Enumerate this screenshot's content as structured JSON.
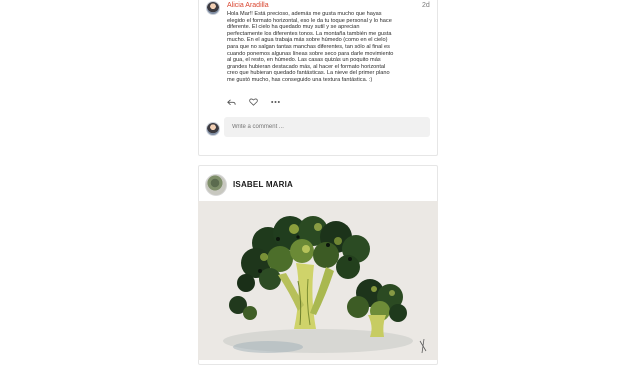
{
  "comment": {
    "author": "Alicia Aradilla",
    "time": "2d",
    "body": "Hola Mar!! Está precioso, además me gusta mucho que hayas\nelegido el formato horizontal, eso le da tu toque personal y lo hace\ndiferente. El cielo ha quedado muy sutil y se aprecian\nperfectamente los diferentes tonos. La montaña también me gusta\nmucho. En el agua trabaja más sobre húmedo (como en el cielo)\npara que no salgan tantas manchas diferentes, tan sólo al final es\ncuando ponemos algunas líneas sobre seco para darle movimiento\nal gua, el resto, en húmedo. Las casas quizás un poquito más\ngrandes hubieran destacado más, al hacer el formato horizontal\ncreo que hubieran quedado fantásticas. La nieve del primer plano\nme gustó mucho, has conseguido una textura fantástica. :)",
    "actions": {
      "reply_icon": "reply-icon",
      "like_icon": "heart-icon",
      "more_icon": "more-icon"
    }
  },
  "comment_input": {
    "placeholder": "Write a comment ..."
  },
  "post": {
    "author": "ISABEL MARIA",
    "image_subject": "watercolor-broccoli"
  },
  "colors": {
    "author_link": "#d9452f",
    "input_bg": "#f1f1f1",
    "border": "#e6e6e6"
  }
}
